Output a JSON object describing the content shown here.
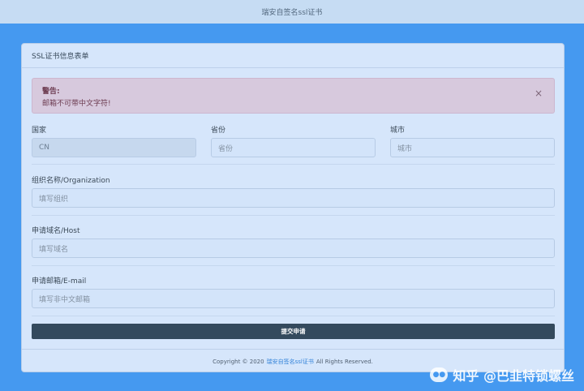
{
  "top_bar": {
    "title": "瑞安自签名ssl证书"
  },
  "card": {
    "header": "SSL证书信息表单",
    "alert": {
      "title": "警告:",
      "message": "邮箱不可带中文字符!",
      "close": "×"
    },
    "fields": {
      "country": {
        "label": "国家",
        "value": "CN"
      },
      "province": {
        "label": "省份",
        "placeholder": "省份"
      },
      "city": {
        "label": "城市",
        "placeholder": "城市"
      },
      "organization": {
        "label": "组织名称/Organization",
        "placeholder": "填写组织"
      },
      "host": {
        "label": "申请域名/Host",
        "placeholder": "填写域名"
      },
      "email": {
        "label": "申请邮箱/E-mail",
        "placeholder": "填写非中文邮箱"
      }
    },
    "submit_label": "提交申请"
  },
  "footer": {
    "prefix": "Copyright © 2020",
    "link": "瑞安自签名ssl证书",
    "suffix": "All Rights Reserved."
  },
  "watermark": {
    "icon": "wechat-icon",
    "text": "知乎 @巴韭特锁螺丝"
  },
  "colors": {
    "page_bg": "#4599f0",
    "card_bg": "#d6e6fb",
    "alert_bg": "#d7c9dd",
    "submit_bg": "#344a5d",
    "link": "#3584d9"
  }
}
